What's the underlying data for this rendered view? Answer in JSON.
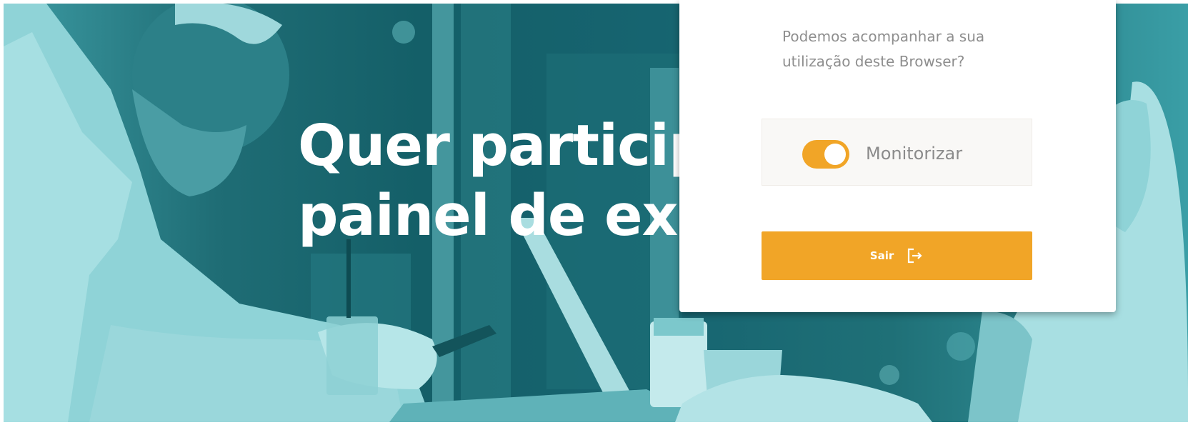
{
  "hero": {
    "title_line_1": "Quer particip",
    "title_line_2": "painel de exc",
    "overlay_color": "#1b6770"
  },
  "consent": {
    "question": "Podemos acompanhar a sua utilização deste Browser?",
    "toggle": {
      "label": "Monitorizar",
      "checked": true
    },
    "exit_button": {
      "label": "Sair",
      "icon": "exit-icon"
    }
  },
  "colors": {
    "accent": "#f1a527",
    "card_background": "#ffffff",
    "text_muted": "#8e8e8e",
    "toggle_box_background": "#f9f8f6"
  }
}
